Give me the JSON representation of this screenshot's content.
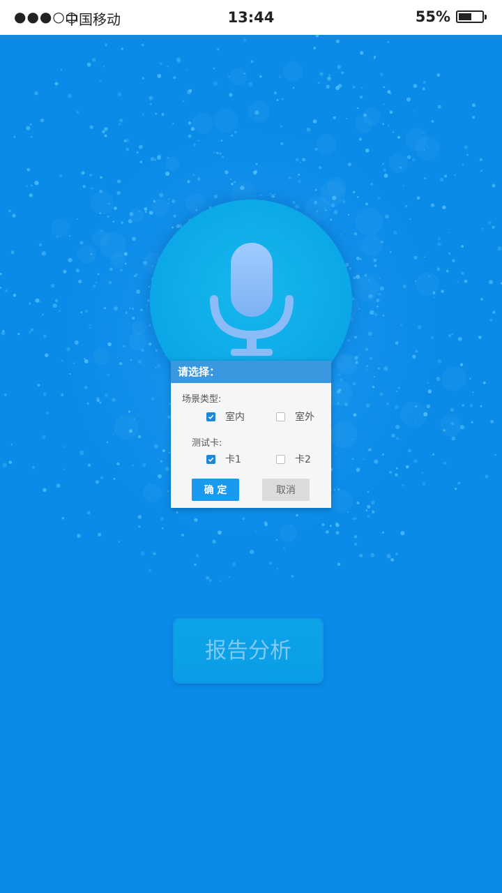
{
  "status_bar": {
    "signal": "●●●○○",
    "carrier": "中国移动",
    "time": "13:44",
    "battery_percent": "55%",
    "battery_level": 0.55
  },
  "mic": {
    "icon": "microphone-icon"
  },
  "dialog": {
    "title": "请选择：",
    "scene_label": "场景类型:",
    "scene_options": [
      {
        "label": "室内",
        "checked": true
      },
      {
        "label": "室外",
        "checked": false
      }
    ],
    "card_label": "测试卡:",
    "card_options": [
      {
        "label": "卡1",
        "checked": true
      },
      {
        "label": "卡2",
        "checked": false
      }
    ],
    "ok_label": "确 定",
    "cancel_label": "取消"
  },
  "report_button": {
    "label": "报告分析"
  },
  "colors": {
    "background": "#0a8be8",
    "dialog_header": "#3a98e0",
    "ok_button": "#1a9aee",
    "mic_circle": "#0aa6e6"
  }
}
